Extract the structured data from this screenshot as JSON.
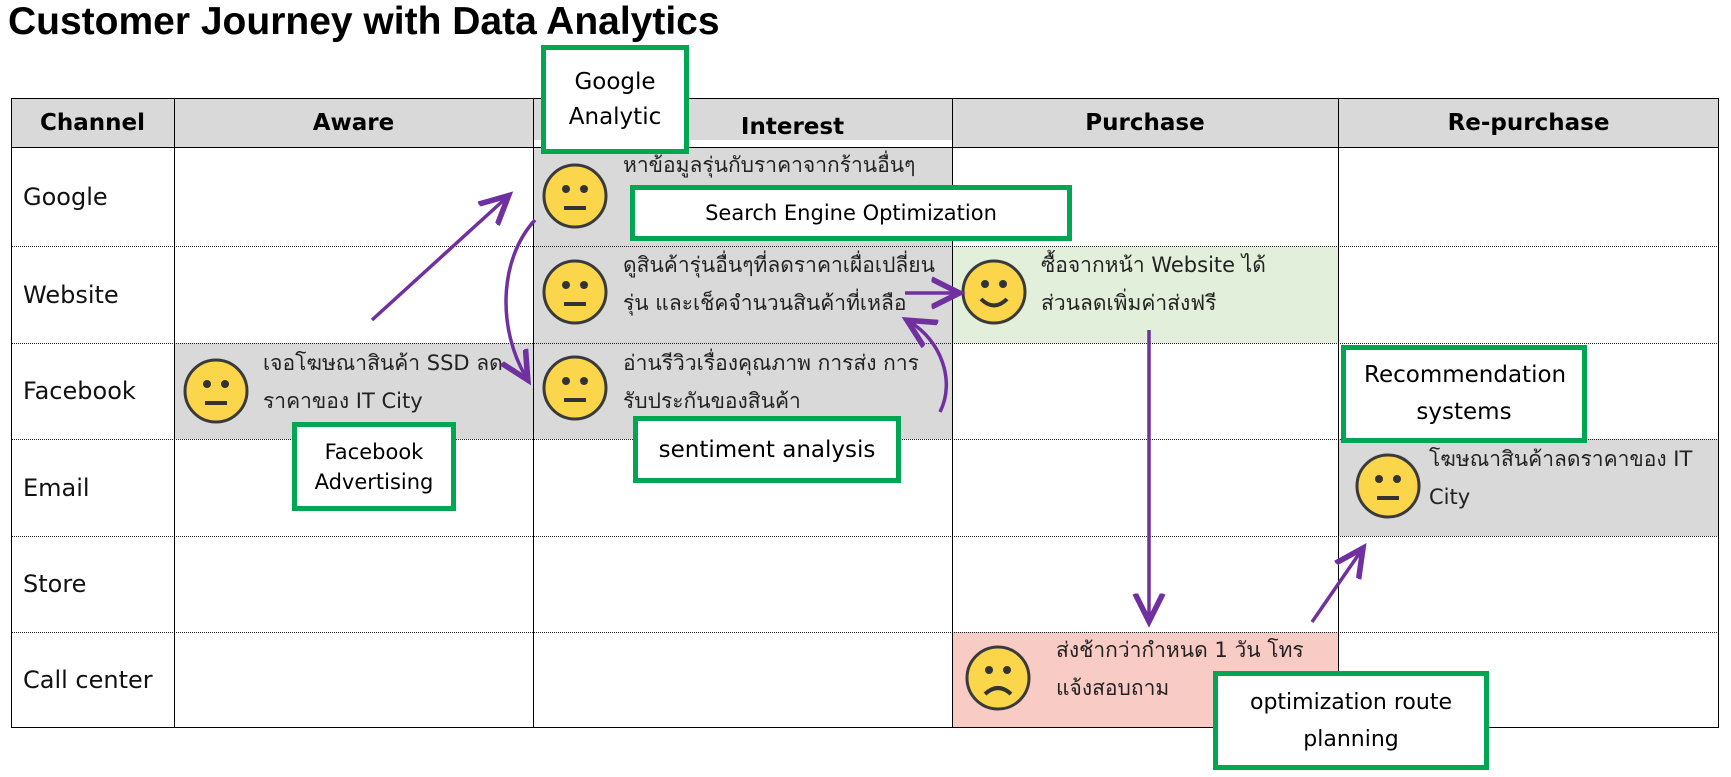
{
  "title": "Customer Journey with Data Analytics",
  "columns": [
    "Channel",
    "Aware",
    "Interest",
    "Purchase",
    "Re-purchase"
  ],
  "rows": [
    "Google",
    "Website",
    "Facebook",
    "Email",
    "Store",
    "Call center"
  ],
  "touchpoints": [
    {
      "id": "aware-facebook",
      "text": "เจอโฆษณาสินค้า SSD ลดราคาของ IT City",
      "mood": "neutral",
      "color": "#d9d9d9"
    },
    {
      "id": "interest-google",
      "text": "หาข้อมูลรุ่นกับราคาจากร้านอื่นๆ",
      "mood": "neutral",
      "color": "#d9d9d9"
    },
    {
      "id": "interest-website",
      "text": "ดูสินค้ารุ่นอื่นๆที่ลดราคาเผื่อเปลี่ยนรุ่น และเช็คจำนวนสินค้าที่เหลือ",
      "mood": "neutral",
      "color": "#d9d9d9"
    },
    {
      "id": "interest-facebook",
      "text": "อ่านรีวิวเรื่องคุณภาพ การส่ง การรับประกันของสินค้า",
      "mood": "neutral",
      "color": "#d9d9d9"
    },
    {
      "id": "purchase-website",
      "text": "ซื้อจากหน้า Website ได้ส่วนลดเพิ่มค่าส่งฟรี",
      "mood": "happy",
      "color": "#e2efda"
    },
    {
      "id": "purchase-callcenter",
      "text": "ส่งช้ากว่ากำหนด 1 วัน โทรแจ้งสอบถาม",
      "mood": "sad",
      "color": "#f8cbc4"
    },
    {
      "id": "repurchase-email",
      "text": "โฆษณาสินค้าลดราคาของ IT City",
      "mood": "neutral",
      "color": "#d9d9d9"
    }
  ],
  "analytics_labels": {
    "google_analytic": "Google Analytic",
    "seo": "Search Engine Optimization",
    "facebook_ads": "Facebook Advertising",
    "sentiment": "sentiment analysis",
    "recommendation": "Recommendation systems",
    "route": "optimization route planning"
  },
  "colors": {
    "analytics_border": "#00a651",
    "arrow": "#7030a0",
    "face": "#fbd64a",
    "header": "#d9d9d9"
  }
}
